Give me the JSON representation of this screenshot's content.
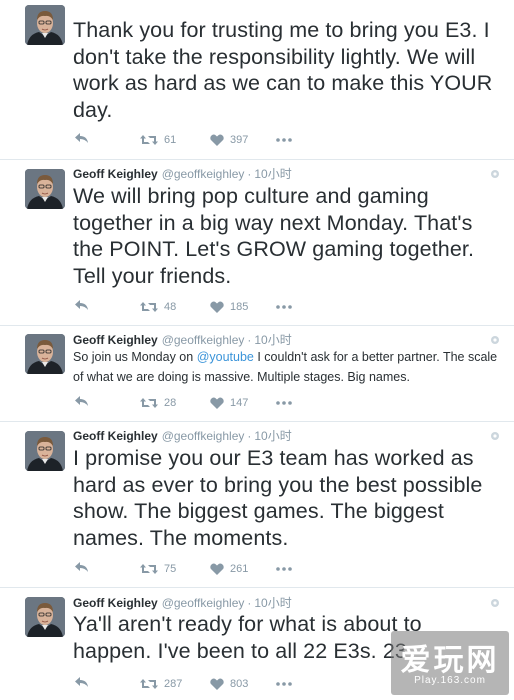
{
  "tweets": [
    {
      "name": "",
      "handle": "",
      "time": "",
      "text": "Thank you for trusting me to bring you E3. I don't take the responsibility lightly. We will work as hard as we can to make this YOUR day.",
      "retweets": "61",
      "likes": "397"
    },
    {
      "name": "Geoff Keighley",
      "handle": "@geoffkeighley",
      "time": "10小时",
      "text": "We will bring pop culture and gaming together in a big way next Monday. That's the POINT. Let's GROW gaming together. Tell your friends.",
      "retweets": "48",
      "likes": "185"
    },
    {
      "name": "Geoff Keighley",
      "handle": "@geoffkeighley",
      "time": "10小时",
      "text_before": "So join us Monday on ",
      "mention": "@youtube",
      "text_after": " I couldn't ask for a better partner. The scale of what we are doing is massive. Multiple stages. Big names.",
      "retweets": "28",
      "likes": "147"
    },
    {
      "name": "Geoff Keighley",
      "handle": "@geoffkeighley",
      "time": "10小时",
      "text": "I promise you our E3 team has worked as hard as ever to bring you the best possible show. The biggest games. The biggest names. The moments.",
      "retweets": "75",
      "likes": "261"
    },
    {
      "name": "Geoff Keighley",
      "handle": "@geoffkeighley",
      "time": "10小时",
      "text": "Ya'll aren't ready for what is about to happen. I've been to all 22 E3s. 23",
      "retweets": "287",
      "likes": "803"
    }
  ],
  "separator": "·",
  "watermark": {
    "main": "爱玩网",
    "sub": "Play.163.com"
  },
  "colors": {
    "text": "#292f33",
    "muted": "#8899a6",
    "link": "#3b94d9",
    "border": "#e1e8ed"
  },
  "icons": [
    "avatar",
    "gear-icon",
    "reply-icon",
    "retweet-icon",
    "heart-icon",
    "more-icon"
  ]
}
